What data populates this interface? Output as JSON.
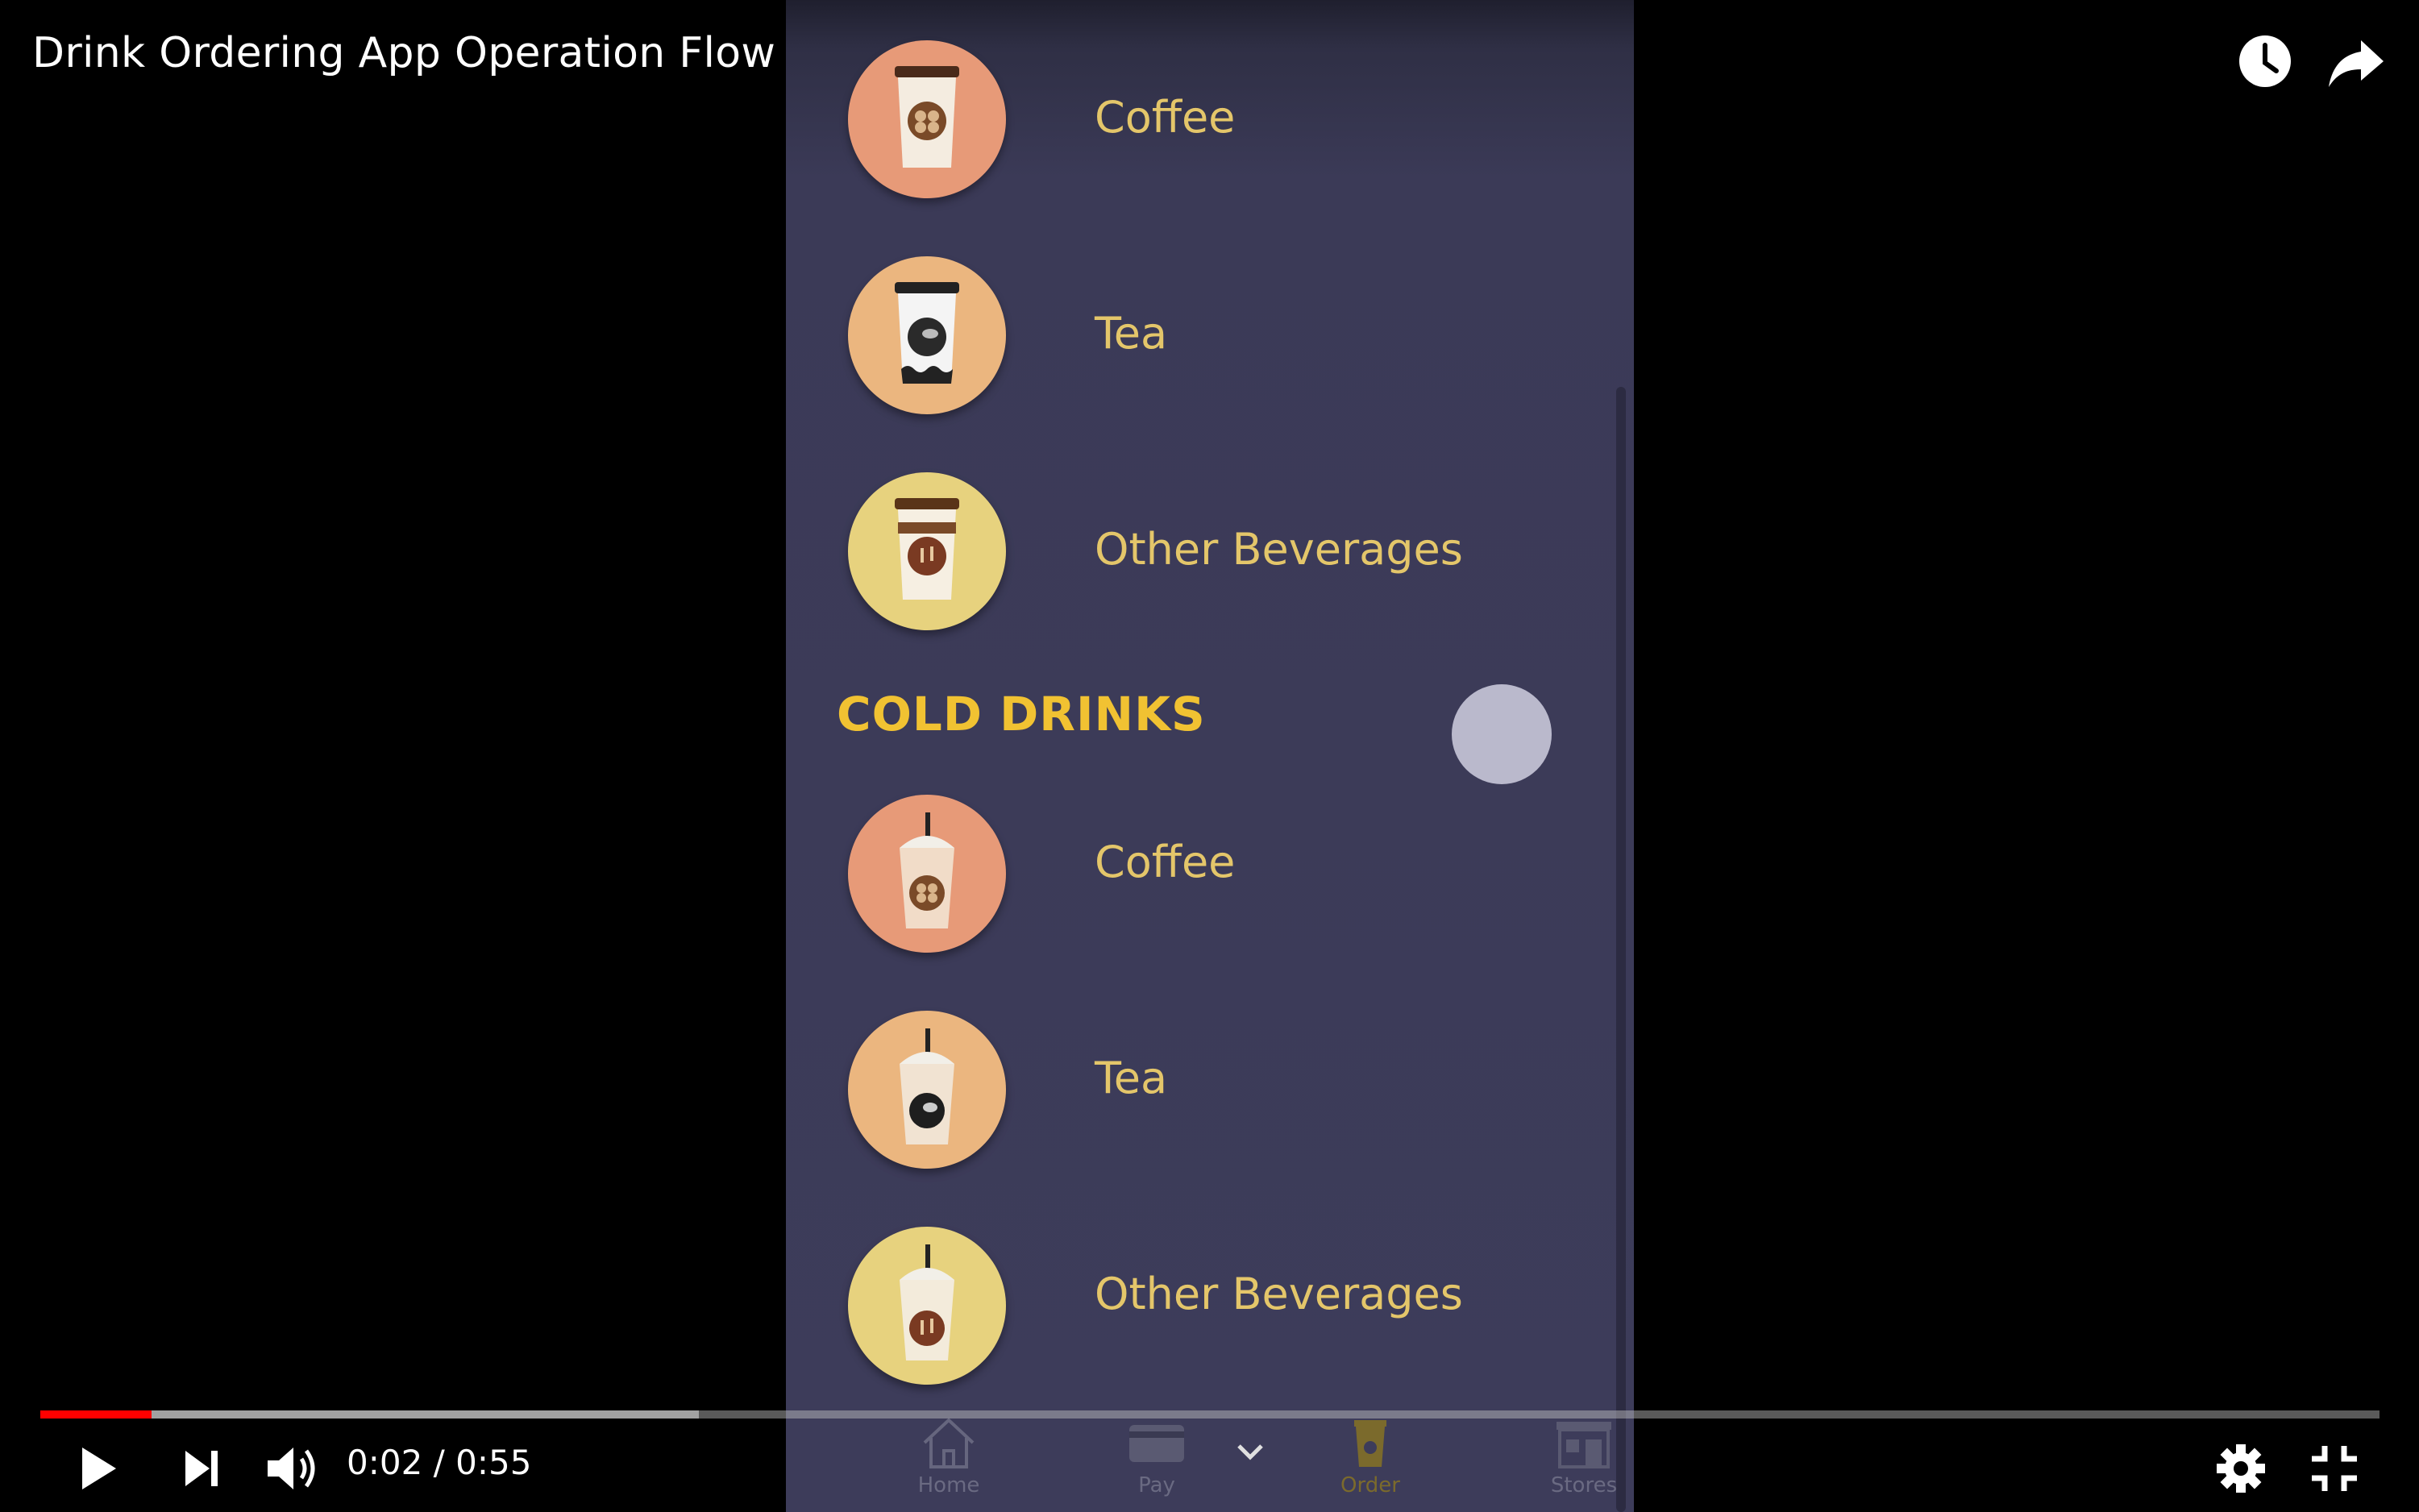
{
  "player": {
    "title": "Drink Ordering App Operation Flow",
    "time_display": "0:02 / 0:55",
    "progress_played_fraction": 0.0476,
    "progress_buffered_fraction": 0.2817,
    "icons": [
      "watch-later-icon",
      "share-icon",
      "play-icon",
      "next-icon",
      "volume-icon",
      "settings-icon",
      "exit-fullscreen-icon"
    ]
  },
  "app": {
    "hot_items": [
      {
        "label": "Coffee",
        "circle_color": "#e79a78"
      },
      {
        "label": "Tea",
        "circle_color": "#ebb67f"
      },
      {
        "label": "Other Beverages",
        "circle_color": "#e7d27e"
      }
    ],
    "cold_section_title": "COLD DRINKS",
    "cold_items": [
      {
        "label": "Coffee",
        "circle_color": "#e79a78"
      },
      {
        "label": "Tea",
        "circle_color": "#ebb67f"
      },
      {
        "label": "Other Beverages",
        "circle_color": "#e7d27e"
      }
    ],
    "nav": [
      {
        "label": "Home"
      },
      {
        "label": "Pay"
      },
      {
        "label": "Order"
      },
      {
        "label": "Stores"
      }
    ],
    "colors": {
      "label": "#e4c66a",
      "section": "#f1c232",
      "background": "#3d3c5a"
    }
  }
}
